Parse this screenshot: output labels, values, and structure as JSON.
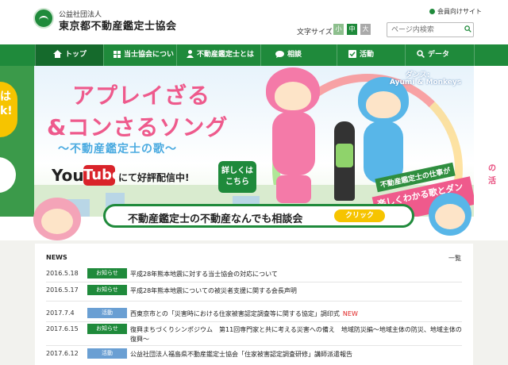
{
  "header": {
    "org_small": "公益社団法人",
    "org_name": "東京都不動産鑑定士協会",
    "member_link": "会員向けサイト",
    "font_size_label": "文字サイズ",
    "font_sizes": [
      "小",
      "中",
      "大"
    ],
    "search_placeholder": "ページ内検索"
  },
  "nav": {
    "items": [
      {
        "label": "トップ",
        "icon": "home-icon"
      },
      {
        "label": "当士協会について",
        "icon": "grid-icon"
      },
      {
        "label": "不動産鑑定士とは",
        "icon": "person-icon"
      },
      {
        "label": "相談",
        "icon": "speech-bubble-icon"
      },
      {
        "label": "活動",
        "icon": "checkbox-icon"
      },
      {
        "label": "データ",
        "icon": "search-icon"
      }
    ]
  },
  "hero": {
    "side_left_text": "は k!",
    "side_right_words": [
      "の",
      "活"
    ],
    "title_line1": "アプレイざる",
    "title_line2": "&コンさるソング",
    "title_line3": "〜不動産鑑定士の歌〜",
    "youtube_you": "You",
    "youtube_tube": "Tube",
    "youtube_after": "にて好評配信中!",
    "detail_button": "詳しくは こちら",
    "dance_label": "ダンス:",
    "dance_names": "Ayumi & Monkeys",
    "ribbon_1": "不動産鑑定士の仕事が",
    "ribbon_2": "楽しくわかる歌とダンス"
  },
  "consult": {
    "text": "不動産鑑定士の不動産なんでも相談会",
    "click_label": "クリック"
  },
  "news": {
    "title": "NEWS",
    "more": "一覧",
    "colors": {
      "notice": "#1f8a3b",
      "activity": "#6a9fd3",
      "new": "#e02020"
    },
    "items": [
      {
        "date": "2016.5.18",
        "category": "お知らせ",
        "type": "notice",
        "text": "平成28年熊本地震に対する当士協会の対応について",
        "new": ""
      },
      {
        "date": "2016.5.17",
        "category": "お知らせ",
        "type": "notice",
        "text": "平成28年熊本地震についての被災者支援に関する会長声明",
        "new": ""
      },
      {
        "date": "2017.7.4",
        "category": "活動",
        "type": "activity",
        "text": "西東京市との「災害時における住家被害認定調査等に関する協定」調印式",
        "new": "NEW"
      },
      {
        "date": "2017.6.15",
        "category": "お知らせ",
        "type": "notice",
        "text": "復興まちづくりシンポジウム　第11回専門家と共に考える災害への備え　地域防災編〜地域主体の防災、地域主体の復興〜",
        "new": ""
      },
      {
        "date": "2017.6.12",
        "category": "活動",
        "type": "activity",
        "text": "公益社団法人福島県不動産鑑定士協会「住家被害認定調査研修」講師派遣報告",
        "new": ""
      }
    ]
  }
}
